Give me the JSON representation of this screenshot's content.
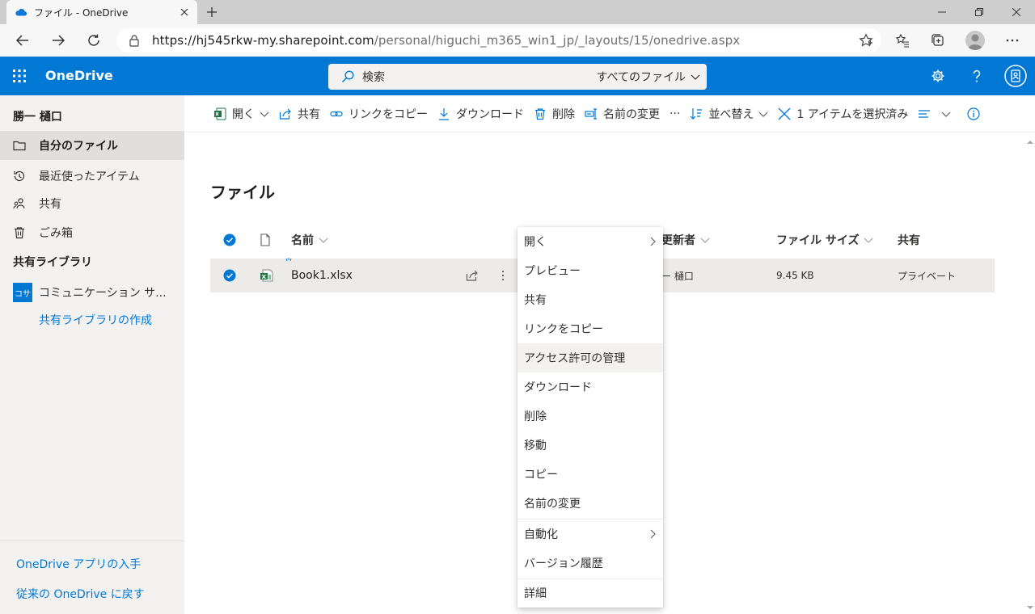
{
  "browser": {
    "tab_title": "ファイル - OneDrive",
    "url_base": "https://hj545rkw-my.sharepoint.com",
    "url_path": "/personal/higuchi_m365_win1_jp/_layouts/15/onedrive.aspx"
  },
  "app": {
    "brand": "OneDrive",
    "search_placeholder": "検索",
    "search_scope": "すべてのファイル",
    "accent": "#0078d4"
  },
  "sidebar": {
    "user": "勝一 樋口",
    "items": [
      {
        "label": "自分のファイル",
        "icon": "folder-icon",
        "selected": true
      },
      {
        "label": "最近使ったアイテム",
        "icon": "history-icon"
      },
      {
        "label": "共有",
        "icon": "people-icon"
      },
      {
        "label": "ごみ箱",
        "icon": "trash-icon"
      }
    ],
    "shared_heading": "共有ライブラリ",
    "library": {
      "badge": "コサ",
      "label": "コミュニケーション サ..."
    },
    "create_library": "共有ライブラリの作成",
    "get_app": "OneDrive アプリの入手",
    "classic": "従来の OneDrive に戻す"
  },
  "toolbar": {
    "open": "開く",
    "share": "共有",
    "copy_link": "リンクをコピー",
    "download": "ダウンロード",
    "delete": "削除",
    "rename": "名前の変更",
    "more": "···",
    "sort": "並べ替え",
    "selected": "1 アイテムを選択済み"
  },
  "main": {
    "title": "ファイル",
    "columns": {
      "name": "名前",
      "modified_by": "更新者",
      "size": "ファイル サイズ",
      "sharing": "共有"
    },
    "file": {
      "name": "Book1.xlsx",
      "modified_by": "ー 樋口",
      "size": "9.45 KB",
      "sharing": "プライベート"
    }
  },
  "context_menu": {
    "items": [
      {
        "label": "開く",
        "submenu": true
      },
      {
        "label": "プレビュー"
      },
      {
        "label": "共有"
      },
      {
        "label": "リンクをコピー"
      },
      {
        "label": "アクセス許可の管理"
      },
      {
        "label": "ダウンロード"
      },
      {
        "label": "削除"
      },
      {
        "label": "移動"
      },
      {
        "label": "コピー"
      },
      {
        "label": "名前の変更"
      },
      {
        "label": "自動化",
        "submenu": true
      },
      {
        "label": "バージョン履歴"
      },
      {
        "label": "詳細"
      }
    ]
  }
}
